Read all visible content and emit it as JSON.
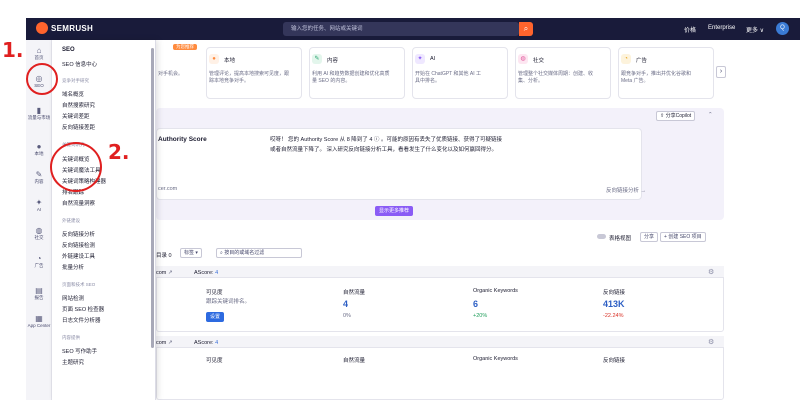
{
  "topbar": {
    "logo": "SEMRUSH",
    "search_placeholder": "输入您的任务、网站或关键词",
    "nav": [
      "价格",
      "Enterprise",
      "更多 ∨"
    ],
    "avatar_letter": "Q"
  },
  "rail": [
    {
      "icon": "home-icon",
      "glyph": "⌂",
      "label": "首页"
    },
    {
      "icon": "seo-icon",
      "glyph": "◎",
      "label": "SEO"
    },
    {
      "icon": "chart-icon",
      "glyph": "▮",
      "label": "流量与市场"
    },
    {
      "icon": "location-icon",
      "glyph": "●",
      "label": "本地"
    },
    {
      "icon": "pen-icon",
      "glyph": "✎",
      "label": "内容"
    },
    {
      "icon": "ai-icon",
      "glyph": "✦",
      "label": "AI"
    },
    {
      "icon": "social-icon",
      "glyph": "◍",
      "label": "社交"
    },
    {
      "icon": "ads-icon",
      "glyph": "◔",
      "label": "广告"
    },
    {
      "icon": "report-icon",
      "glyph": "▤",
      "label": "报告"
    },
    {
      "icon": "apps-icon",
      "glyph": "▦",
      "label": "App Center"
    }
  ],
  "flyout": {
    "title": "SEO",
    "items_top": [
      "SEO 信息中心"
    ],
    "sections": [
      {
        "head": "竞争对手研究",
        "items": [
          "域名概览",
          "自然搜索研究",
          "关键词差距",
          "反向链接差距"
        ]
      },
      {
        "head": "关键词研究",
        "items": [
          "关键词概览",
          "关键词魔法工具",
          "关键词策略构建器",
          "排名跟踪",
          "自然流量洞察"
        ]
      },
      {
        "head": "外链建设",
        "items": [
          "反向链接分析",
          "反向链接检测",
          "外链建设工具",
          "批量分析"
        ]
      },
      {
        "head": "页面和技术 SEO",
        "items": [
          "网站检测",
          "页面 SEO 检查器",
          "日志文件分析器"
        ]
      },
      {
        "head": "内容提供",
        "items": [
          "SEO 写作助手",
          "主题研究"
        ]
      }
    ]
  },
  "tools": [
    {
      "name": "本地",
      "desc": [
        "管理评论，提高本地搜索可见度，跟",
        "踪本地竞争对手。"
      ],
      "icon": "pin-icon",
      "glyph": "●",
      "color": "#ff8a3d",
      "bg": "#fff1e6"
    },
    {
      "name": "内容",
      "desc": [
        "利用 AI 和趋势数据创建和优化高质",
        "量 SEO 的内容。"
      ],
      "icon": "pen-icon",
      "glyph": "✎",
      "color": "#22a06b",
      "bg": "#e3f6ec"
    },
    {
      "name": "AI",
      "desc": [
        "开始在 ChatGPT 和其他 AI 工",
        "具中排名。"
      ],
      "icon": "ai-sparkle-icon",
      "glyph": "✦",
      "color": "#8a5cf5",
      "bg": "#efe8ff"
    },
    {
      "name": "社交",
      "desc": [
        "管理整个社交媒体周期：创建、收",
        "集、分析。"
      ],
      "icon": "social-icon",
      "glyph": "◍",
      "color": "#e0559a",
      "bg": "#fde6f1"
    },
    {
      "name": "广告",
      "desc": [
        "跟竞争对手，推出并优化谷歌和",
        "Meta 广告。"
      ],
      "icon": "ads-icon",
      "glyph": "◔",
      "color": "#e8a317",
      "bg": "#fdf3dc"
    }
  ],
  "first_card_desc": "对手机会。",
  "new_badge": "为您推荐",
  "copilot_label": "分享Copilot",
  "authority": {
    "title": "Authority Score",
    "message_line1": "哎呀！ 您的 Authority Score 从 8 降到了 4 ⓘ 。可能的原因有丢失了优质链接、获得了可疑链接",
    "message_line2": "或者自然流量下降了。 深入研究反向链接分析工具，看看发生了什么变化以及如何赢回得分。",
    "site_suffix": "cer.com",
    "link": "反向链接分析 →",
    "more_button": "显示更多推荐"
  },
  "projects_bar": {
    "filter_label": "目录 0",
    "tag_label": "标签",
    "search_placeholder": "按目的或域名过滤",
    "view_toggle": "表格视图",
    "share": "分享",
    "create": "+ 创建 SEO 项目"
  },
  "projects": [
    {
      "domain_suffix": "com",
      "ascore_label": "AScore:",
      "ascore": "4",
      "visibility_label": "可见度",
      "visibility_text": "跟踪关键词排名。",
      "setup": "设置",
      "traffic_label": "自然流量",
      "traffic": "4",
      "traffic_change": "0%",
      "kw_label": "Organic Keywords",
      "kw": "6",
      "kw_change": "+20%",
      "bl_label": "反向链接",
      "bl": "413K",
      "bl_change": "-22.24%"
    },
    {
      "domain_suffix": "com",
      "ascore_label": "AScore:",
      "ascore": "4",
      "visibility_label": "可见度",
      "traffic_label": "自然流量",
      "kw_label": "Organic Keywords",
      "bl_label": "反向链接"
    }
  ],
  "annotations": [
    "1.",
    "2."
  ]
}
